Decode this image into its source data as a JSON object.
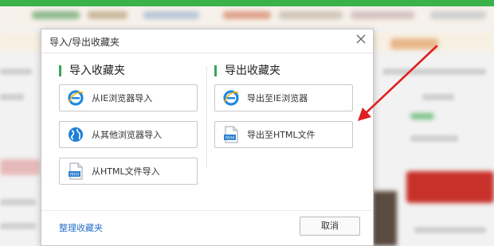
{
  "dialog": {
    "title": "导入/导出收藏夹",
    "import_section": {
      "title": "导入收藏夹",
      "buttons": [
        {
          "label": "从IE浏览器导入",
          "icon": "ie-icon"
        },
        {
          "label": "从其他浏览器导入",
          "icon": "globe-icon"
        },
        {
          "label": "从HTML文件导入",
          "icon": "html-file-icon"
        }
      ]
    },
    "export_section": {
      "title": "导出收藏夹",
      "buttons": [
        {
          "label": "导出至IE浏览器",
          "icon": "ie-icon"
        },
        {
          "label": "导出至HTML文件",
          "icon": "html-file-icon"
        }
      ]
    },
    "manage_link": "整理收藏夹",
    "cancel_label": "取消",
    "icon_badge_text": "html"
  },
  "colors": {
    "accent_green": "#3aa35a",
    "link_blue": "#2a6fc9",
    "annotation_red": "#e02020"
  }
}
